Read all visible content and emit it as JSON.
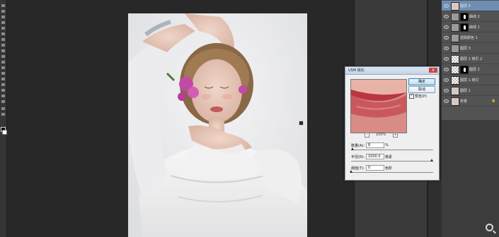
{
  "usm_dialog": {
    "title": "USM 锐化",
    "close_glyph": "x",
    "ok_label": "确定",
    "cancel_label": "取消",
    "preview_label": "预览(P)",
    "preview_checked": true,
    "zoom_out_glyph": "-",
    "zoom_in_glyph": "+",
    "zoom_level": "100%",
    "amount": {
      "label": "数量(A):",
      "value": "8",
      "unit": "%",
      "level": 0.02
    },
    "radius": {
      "label": "半径(R):",
      "value": "1000.0",
      "unit": "像素",
      "level": 1.0
    },
    "threshold": {
      "label": "阈值(T):",
      "value": "0",
      "unit": "色阶",
      "level": 0.0
    }
  },
  "layers": [
    {
      "name": "图层 4",
      "thumb": "portrait",
      "active": true
    },
    {
      "name": "曲线 2",
      "thumb": "adjust",
      "mask": true
    },
    {
      "name": "曲线 1",
      "thumb": "adjust",
      "mask": true
    },
    {
      "name": "选取颜色 1",
      "thumb": "grey"
    },
    {
      "name": "图层 3",
      "thumb": "grey"
    },
    {
      "name": "图层 1 拷贝 2",
      "thumb": "checker"
    },
    {
      "name": "图层 2",
      "thumb": "checker",
      "mask": true
    },
    {
      "name": "图层 1 拷贝",
      "thumb": "checker"
    },
    {
      "name": "图层 1",
      "thumb": "portrait"
    },
    {
      "name": "背景",
      "thumb": "portrait",
      "badge": "🔒"
    }
  ],
  "colors": {
    "workspace": "#282828",
    "panel": "#535353",
    "active_layer": "#6e8fb3",
    "dialog_bg": "#efefef"
  }
}
